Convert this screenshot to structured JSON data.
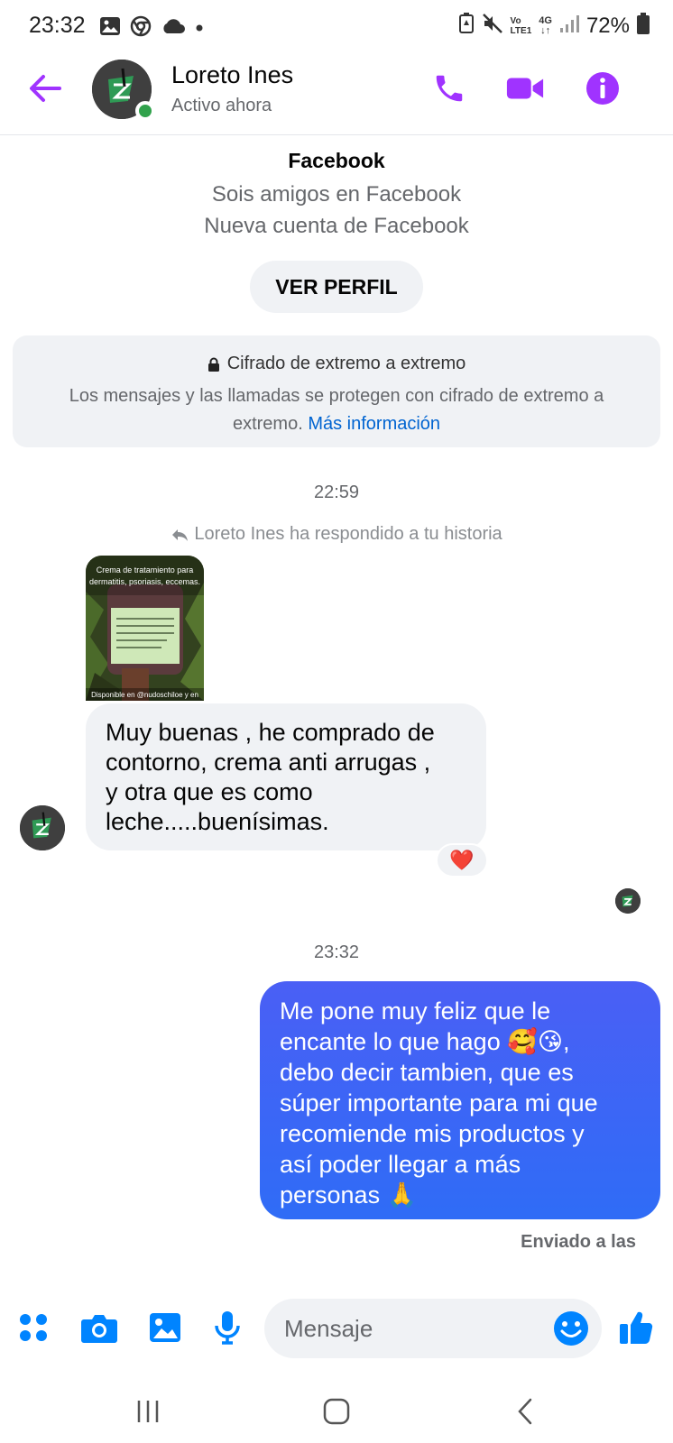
{
  "status_bar": {
    "time": "23:32",
    "battery": "72%",
    "network_top": "4G",
    "volte_top": "Vo",
    "volte_bottom": "LTE1"
  },
  "header": {
    "contact_name": "Loreto Ines",
    "contact_status": "Activo ahora",
    "accent_color": "#a033ff"
  },
  "intro": {
    "platform": "Facebook",
    "line1": "Sois amigos en Facebook",
    "line2": "Nueva cuenta de Facebook",
    "profile_button": "VER PERFIL"
  },
  "encryption": {
    "title": "Cifrado de extremo a extremo",
    "body": "Los mensajes y las llamadas se protegen con cifrado de extremo a extremo.",
    "link": "Más información"
  },
  "thread": {
    "time_1": "22:59",
    "story_reply_note": "Loreto Ines ha respondido a tu historia",
    "story_caption_top": "Crema de tratamiento para dermatitis, psoriasis, eccemas.",
    "story_caption_bottom": "Disponible en @nudoschiloe y en",
    "incoming_message": "Muy buenas , he comprado de\ncontorno, crema anti  arrugas ,\ny otra que es como\nleche.....buenísimas.",
    "reaction": "❤️",
    "time_2": "23:32",
    "outgoing_message": "Me pone muy feliz que le\nencante lo que hago 🥰😘,\ndebo decir tambien, que es\nsúper importante para mi que\nrecomiende mis productos y\nasí poder llegar a más\npersonas 🙏",
    "sent_label": "Enviado a las"
  },
  "composer": {
    "placeholder": "Mensaje",
    "icon_color": "#0084ff"
  }
}
